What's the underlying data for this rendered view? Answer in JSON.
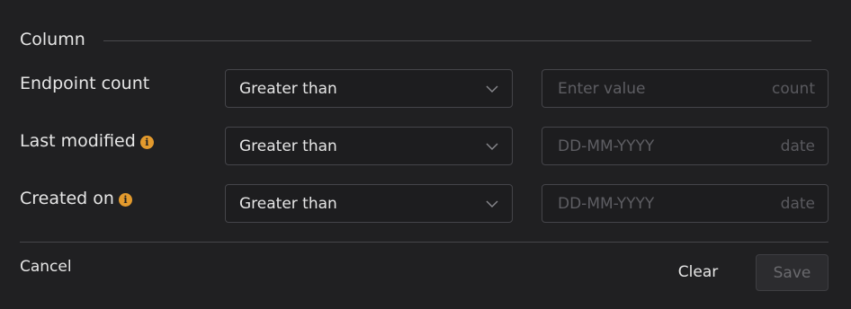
{
  "section": {
    "title": "Column"
  },
  "filters": [
    {
      "label": "Endpoint count",
      "has_info": false,
      "operator": "Greater than",
      "value": "",
      "placeholder": "Enter value",
      "suffix": "count"
    },
    {
      "label": "Last modified",
      "has_info": true,
      "operator": "Greater than",
      "value": "",
      "placeholder": "DD-MM-YYYY",
      "suffix": "date"
    },
    {
      "label": "Created on",
      "has_info": true,
      "operator": "Greater than",
      "value": "",
      "placeholder": "DD-MM-YYYY",
      "suffix": "date"
    }
  ],
  "icons": {
    "info": "info-icon",
    "dropdown": "chevron-down-icon"
  },
  "info_glyph": "i",
  "footer": {
    "cancel_label": "Cancel",
    "clear_label": "Clear",
    "save_label": "Save",
    "save_disabled": true
  },
  "colors": {
    "background": "#202022",
    "border": "#45454a",
    "info_accent": "#e39a2d",
    "placeholder": "#5e5e63",
    "text": "#e6e6e6"
  }
}
